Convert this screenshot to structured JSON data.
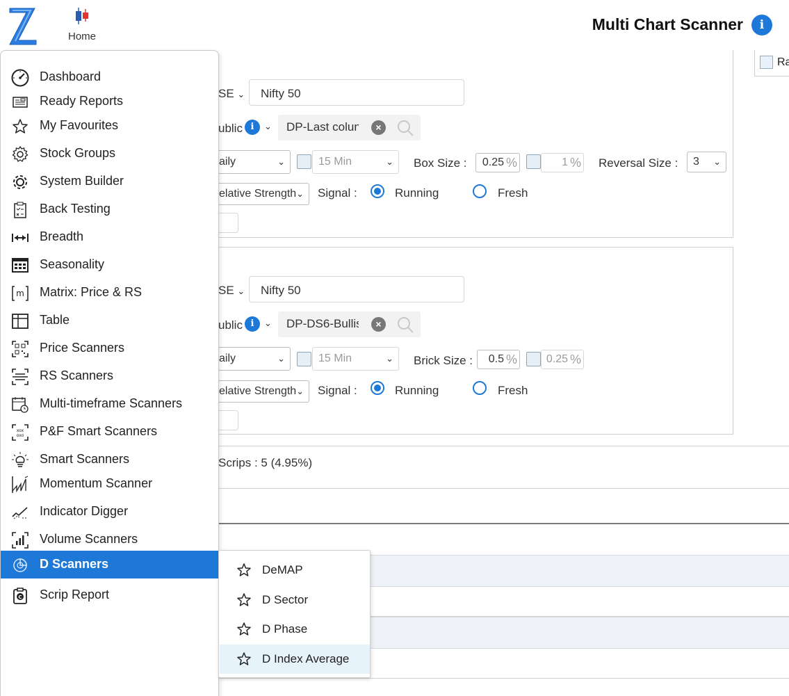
{
  "header": {
    "home_label": "Home",
    "title": "Multi Chart Scanner",
    "info_glyph": "i"
  },
  "right_panel": {
    "checkbox_label": "Ra"
  },
  "scanner1": {
    "exchange": "SE",
    "index": "Nifty 50",
    "visibility": "ublic",
    "scan_name": "DP-Last colun",
    "timeframe": "aily",
    "interval": "15 Min",
    "size_label": "Box Size :",
    "size_value": "0.25",
    "alt_size_value": "1",
    "reversal_label": "Reversal Size :",
    "reversal_value": "3",
    "strength": "elative Strength",
    "signal_label": "Signal :",
    "running_label": "Running",
    "fresh_label": "Fresh",
    "percent": "%"
  },
  "scanner2": {
    "exchange": "SE",
    "index": "Nifty 50",
    "visibility": "ublic",
    "scan_name": "DP-DS6-Bullis",
    "timeframe": "aily",
    "interval": "15 Min",
    "size_label": "Brick Size :",
    "size_value": "0.5",
    "alt_size_value": "0.25",
    "strength": "elative Strength",
    "signal_label": "Signal :",
    "running_label": "Running",
    "fresh_label": "Fresh",
    "percent": "%"
  },
  "results": {
    "scrips_text": "Scrips : 5 (4.95%)"
  },
  "sidebar": {
    "items": [
      {
        "label": "Dashboard",
        "icon": "gauge-icon"
      },
      {
        "label": "Ready Reports",
        "icon": "report-icon"
      },
      {
        "label": "My Favourites",
        "icon": "star-icon"
      },
      {
        "label": "Stock Groups",
        "icon": "gear-icon"
      },
      {
        "label": "System Builder",
        "icon": "cog-icon"
      },
      {
        "label": "Back Testing",
        "icon": "clipboard-icon"
      },
      {
        "label": "Breadth",
        "icon": "arrows-width-icon"
      },
      {
        "label": "Seasonality",
        "icon": "calendar-grid-icon"
      },
      {
        "label": "Matrix: Price & RS",
        "icon": "matrix-icon"
      },
      {
        "label": "Table",
        "icon": "table-icon"
      },
      {
        "label": "Price Scanners",
        "icon": "qr-scan-icon"
      },
      {
        "label": "RS Scanners",
        "icon": "scan-lines-icon"
      },
      {
        "label": "Multi-timeframe Scanners",
        "icon": "calendar-clock-icon"
      },
      {
        "label": "P&F Smart Scanners",
        "icon": "pf-scan-icon"
      },
      {
        "label": "Smart Scanners",
        "icon": "bulb-icon"
      },
      {
        "label": "Momentum Scanner",
        "icon": "momentum-icon"
      },
      {
        "label": "Indicator Digger",
        "icon": "trend-icon"
      },
      {
        "label": "Volume Scanners",
        "icon": "volume-bars-icon"
      },
      {
        "label": "D Scanners",
        "icon": "d-scanner-icon"
      },
      {
        "label": "Scrip Report",
        "icon": "scrip-report-icon"
      }
    ]
  },
  "submenu": {
    "items": [
      {
        "label": "DeMAP"
      },
      {
        "label": "D Sector"
      },
      {
        "label": "D Phase"
      },
      {
        "label": "D Index Average"
      }
    ]
  },
  "colors": {
    "accent": "#1e78d8",
    "logo": "#2b7de1"
  }
}
